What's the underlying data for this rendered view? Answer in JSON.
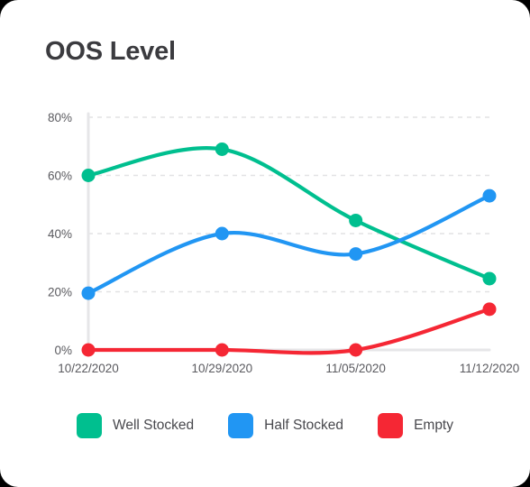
{
  "card": {
    "background": "#ffffff",
    "title": "OOS Level"
  },
  "legend": {
    "position": "bottom-center",
    "items": [
      {
        "label": "Well Stocked",
        "color": "#00bf8f"
      },
      {
        "label": "Half Stocked",
        "color": "#2196f3"
      },
      {
        "label": "Empty",
        "color": "#f52734"
      }
    ]
  },
  "chart_data": {
    "type": "line",
    "title": "OOS Level",
    "xlabel": "",
    "ylabel": "",
    "x": [
      "10/22/2020",
      "10/29/2020",
      "11/05/2020",
      "11/12/2020"
    ],
    "categories": [
      "10/22/2020",
      "10/29/2020",
      "11/05/2020",
      "11/12/2020"
    ],
    "series": [
      {
        "name": "Well Stocked",
        "color": "#00bf8f",
        "values": [
          60,
          69,
          44.5,
          24.5
        ]
      },
      {
        "name": "Half Stocked",
        "color": "#2196f3",
        "values": [
          19.5,
          40,
          33,
          53
        ]
      },
      {
        "name": "Empty",
        "color": "#f52734",
        "values": [
          0,
          0,
          0,
          14
        ]
      }
    ],
    "ylim": [
      0,
      80
    ],
    "yticks": [
      0,
      20,
      40,
      60,
      80
    ],
    "ytick_labels": [
      "0%",
      "20%",
      "40%",
      "60%",
      "80%"
    ],
    "xtick_labels": [
      "10/22/2020",
      "10/29/2020",
      "11/05/2020",
      "11/12/2020"
    ],
    "grid": "horizontal-dashed",
    "smoothing": "spline",
    "markers": true,
    "legend_position": "bottom-center"
  }
}
